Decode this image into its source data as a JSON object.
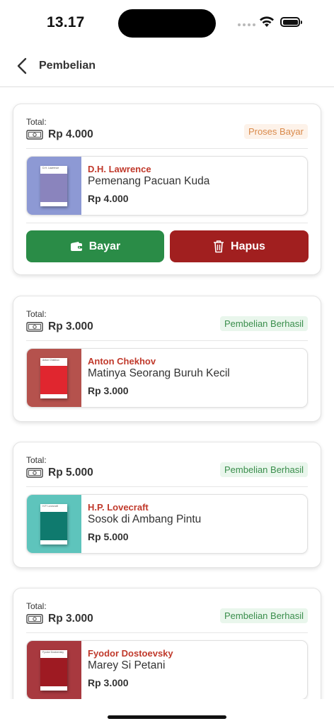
{
  "status_bar": {
    "time": "13.17"
  },
  "header": {
    "title": "Pembelian"
  },
  "orders": [
    {
      "total_label": "Total:",
      "total": "Rp 4.000",
      "status": "Proses Bayar",
      "item": {
        "author": "D.H. Lawrence",
        "title": "Pemenang Pacuan Kuda",
        "price": "Rp 4.000",
        "cover_bg": "#8d99d4",
        "cover": "#8a84bd",
        "cover_text": "D.H. Lawrence · Pemenang Pacuan Kuda"
      },
      "actions": {
        "pay": "Bayar",
        "delete": "Hapus"
      }
    },
    {
      "total_label": "Total:",
      "total": "Rp 3.000",
      "status": "Pembelian Berhasil",
      "item": {
        "author": "Anton Chekhov",
        "title": "Matinya Seorang Buruh Kecil",
        "price": "Rp 3.000",
        "cover_bg": "#b5524d",
        "cover": "#e0262f",
        "cover_text": "Anton Chekhov · Matinya Seorang Buruh Kecil"
      }
    },
    {
      "total_label": "Total:",
      "total": "Rp 5.000",
      "status": "Pembelian Berhasil",
      "item": {
        "author": "H.P. Lovecraft",
        "title": "Sosok di Ambang Pintu",
        "price": "Rp 5.000",
        "cover_bg": "#5ec4bc",
        "cover": "#0f7a6e",
        "cover_text": "H.P. Lovecraft · Sosok di Ambang Pintu"
      }
    },
    {
      "total_label": "Total:",
      "total": "Rp 3.000",
      "status": "Pembelian Berhasil",
      "item": {
        "author": "Fyodor Dostoevsky",
        "title": "Marey Si Petani",
        "price": "Rp 3.000",
        "cover_bg": "#a8393f",
        "cover": "#9e1a22",
        "cover_text": "Fyodor Dostoevsky · Marey Si Petani"
      }
    }
  ],
  "colors": {
    "pay": "#2a8c47",
    "delete": "#a11f1f",
    "author": "#c0392b",
    "pending_text": "#d98a4b",
    "success_text": "#3a8e4c"
  },
  "icons": {
    "back": "chevron-left-icon",
    "cash": "cash-icon",
    "wallet": "wallet-icon",
    "trash": "trash-icon"
  }
}
